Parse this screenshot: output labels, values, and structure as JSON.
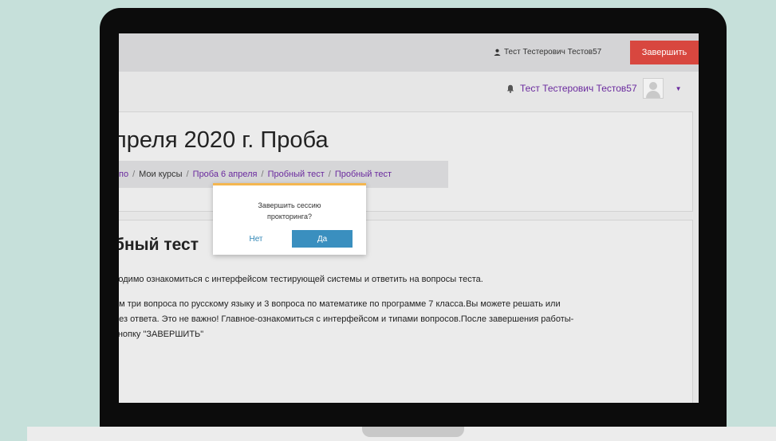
{
  "topbar": {
    "user_name": "Тест Тестерович Тестов57",
    "finish_label": "Завершить"
  },
  "navbar": {
    "user_name": "Тест Тестерович Тестов57"
  },
  "page": {
    "title": "преля 2020 г. Проба"
  },
  "breadcrumb": {
    "items": [
      "по",
      "Мои курсы",
      "Проба 6 апреля",
      "Пробный тест",
      "Пробный тест"
    ],
    "separator": "/"
  },
  "content": {
    "section_title": "бный тест",
    "paragraph1": "ходимо ознакомиться с интерфейсом тестирующей системы и ответить на вопросы теста.",
    "paragraph2_lines": [
      "ем три вопроса по русскому языку и 3 вопроса по математике по программе 7 класса.Вы можете  решать или",
      "без ответа. Это не важно! Главное-ознакомиться с интерфейсом  и типами  вопросов.После завершения работы-",
      "кнопку \"ЗАВЕРШИТЬ\""
    ]
  },
  "popover": {
    "question_line1": "Завершить сессию",
    "question_line2": "прокторинга?",
    "no_label": "Нет",
    "yes_label": "Да"
  },
  "icons": {
    "user": "user-icon",
    "bell": "bell-icon",
    "caret": "caret-down-icon"
  },
  "colors": {
    "finish_button": "#d8473f",
    "link": "#6a2a9e",
    "yes_button": "#3a8fbf",
    "popover_accent": "#f4b650"
  }
}
